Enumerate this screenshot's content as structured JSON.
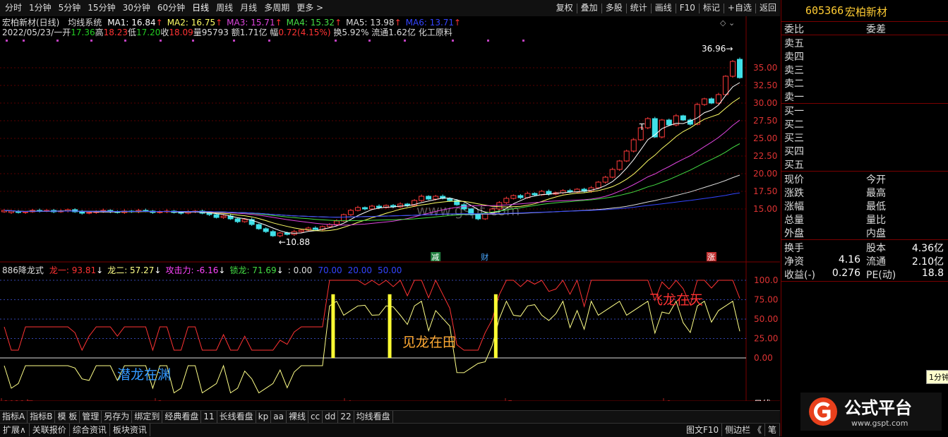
{
  "toolbar": {
    "periods": [
      "分时",
      "1分钟",
      "5分钟",
      "15分钟",
      "30分钟",
      "60分钟",
      "日线",
      "周线",
      "月线",
      "多周期",
      "更多 >"
    ],
    "active_period": "日线",
    "right_buttons": [
      "复权",
      "叠加",
      "多股",
      "统计",
      "画线",
      "F10",
      "标记",
      "+自选",
      "返回"
    ]
  },
  "stock": {
    "title": "宏柏新材(日线)",
    "indicator_name": "均线系统",
    "info_line": {
      "date": "2022/05/23/一",
      "open_label": "开",
      "open": "17.36",
      "high_label": "高",
      "high": "18.23",
      "low_label": "低",
      "low": "17.20",
      "close_label": "收",
      "close": "18.09",
      "vol_label": "量",
      "vol": "95793",
      "amount_label": "额",
      "amount": "1.71亿",
      "range_label": "幅",
      "range": "0.72(4.15%)",
      "turnover_label": "换",
      "turnover": "5.92%",
      "float_label": "流通",
      "float": "1.62亿",
      "sector": "化工原料"
    },
    "ma": [
      {
        "label": "MA1: 16.84",
        "color": "#ffffff"
      },
      {
        "label": "MA2: 16.75",
        "color": "#ffff66"
      },
      {
        "label": "MA3: 15.71",
        "color": "#dd44dd"
      },
      {
        "label": "MA4: 15.32",
        "color": "#44dd44"
      },
      {
        "label": "MA5: 13.98",
        "color": "#dddddd"
      },
      {
        "label": "MA6: 13.71",
        "color": "#3344ff"
      }
    ],
    "high_mark": "36.96",
    "low_mark": "10.88",
    "watermark": "www.gspt.com",
    "event_labels": [
      "减",
      "财",
      "涨"
    ],
    "price_axis": [
      "35.00",
      "32.50",
      "30.00",
      "27.50",
      "25.00",
      "22.50",
      "20.00",
      "17.50",
      "15.00"
    ]
  },
  "sub": {
    "name": "886降龙式",
    "items": [
      {
        "label": "龙一: 93.81",
        "color": "#ff3333"
      },
      {
        "label": "龙二: 57.27",
        "color": "#ffff88"
      },
      {
        "label": "攻击力: -6.16",
        "color": "#ff44ff"
      },
      {
        "label": "锁龙: 71.69",
        "color": "#44dd44"
      },
      {
        "label": ": 0.00",
        "color": "#dddddd"
      },
      {
        "label": "70.00",
        "color": "#3344ff"
      },
      {
        "label": "20.00",
        "color": "#3344ff"
      },
      {
        "label": "50.00",
        "color": "#3344ff"
      }
    ],
    "axis": [
      "100.0",
      "75.00",
      "50.00",
      "25.00",
      "0.00"
    ],
    "texts": [
      "潜龙在渊",
      "见龙在田",
      "飞龙在天"
    ]
  },
  "time_axis": [
    "2022年",
    "3",
    "4",
    "5",
    "6"
  ],
  "period_label": "日线",
  "bottom_tabs": [
    "指标A",
    "指标B",
    "模 板",
    "管理",
    "另存为",
    "绑定到",
    "经典看盘",
    "11",
    "长线看盘",
    "kp",
    "aa",
    "裸线",
    "cc",
    "dd",
    "22",
    "均线看盘"
  ],
  "bottom_bar2": [
    "扩展∧",
    "关联报价",
    "综合资讯",
    "板块资讯"
  ],
  "bottom_right": [
    "图文F10",
    "侧边栏 《",
    "笔"
  ],
  "side": {
    "code": "605366",
    "name": "宏柏新材",
    "ratio_label": "委比",
    "diff_label": "委差",
    "asks": [
      "卖五",
      "卖四",
      "卖三",
      "卖二",
      "卖一"
    ],
    "bids": [
      "买一",
      "买二",
      "买三",
      "买四",
      "买五"
    ],
    "quote_left": [
      "现价",
      "涨跌",
      "涨幅",
      "总量",
      "外盘"
    ],
    "quote_right": [
      "今开",
      "最高",
      "最低",
      "量比",
      "内盘"
    ],
    "fin": [
      {
        "l": "换手",
        "m": "",
        "r": "股本",
        "v": "4.36亿"
      },
      {
        "l": "净资",
        "m": "4.16",
        "r": "流通",
        "v": "2.10亿"
      },
      {
        "l": "收益(-)",
        "m": "0.276",
        "r": "PE(动)",
        "v": "18.8"
      }
    ],
    "tooltip": "1分钟"
  },
  "logo": {
    "text": "公式平台",
    "url": "www.gspt.com"
  },
  "chart_data": {
    "type": "candlestick",
    "symbol": "605366",
    "period": "daily",
    "ylim": [
      9.5,
      37.5
    ],
    "candles": [
      [
        14.6,
        14.8
      ],
      [
        14.5,
        14.7
      ],
      [
        14.6,
        14.5
      ],
      [
        14.5,
        14.6
      ],
      [
        14.6,
        14.8
      ],
      [
        14.8,
        14.7
      ],
      [
        14.7,
        14.8
      ],
      [
        14.8,
        14.6
      ],
      [
        14.6,
        14.7
      ],
      [
        14.7,
        14.9
      ],
      [
        14.9,
        14.6
      ],
      [
        14.6,
        14.4
      ],
      [
        14.4,
        14.5
      ],
      [
        14.5,
        14.6
      ],
      [
        14.6,
        14.8
      ],
      [
        14.8,
        14.6
      ],
      [
        14.6,
        14.5
      ],
      [
        14.5,
        14.7
      ],
      [
        14.7,
        14.6
      ],
      [
        14.6,
        14.8
      ],
      [
        14.8,
        14.7
      ],
      [
        14.7,
        14.5
      ],
      [
        14.5,
        14.6
      ],
      [
        14.6,
        14.7
      ],
      [
        14.7,
        14.5
      ],
      [
        14.5,
        14.4
      ],
      [
        14.4,
        14.6
      ],
      [
        14.6,
        14.7
      ],
      [
        14.7,
        14.4
      ],
      [
        14.4,
        14.2
      ],
      [
        14.2,
        13.8
      ],
      [
        13.8,
        14.0
      ],
      [
        14.0,
        13.6
      ],
      [
        13.6,
        13.2
      ],
      [
        13.2,
        13.5
      ],
      [
        13.5,
        12.8
      ],
      [
        12.8,
        12.2
      ],
      [
        12.2,
        11.8
      ],
      [
        11.8,
        11.2
      ],
      [
        11.2,
        11.6
      ],
      [
        11.6,
        11.4
      ],
      [
        11.4,
        11.8
      ],
      [
        11.8,
        12.0
      ],
      [
        12.0,
        12.3
      ],
      [
        12.3,
        12.1
      ],
      [
        12.1,
        12.5
      ],
      [
        12.5,
        12.8
      ],
      [
        12.8,
        13.3
      ],
      [
        13.3,
        14.2
      ],
      [
        14.2,
        14.8
      ],
      [
        14.8,
        15.2
      ],
      [
        15.2,
        15.0
      ],
      [
        15.0,
        15.4
      ],
      [
        15.4,
        15.2
      ],
      [
        15.2,
        15.5
      ],
      [
        15.5,
        15.3
      ],
      [
        15.3,
        15.7
      ],
      [
        15.7,
        15.5
      ],
      [
        15.5,
        16.2
      ],
      [
        16.2,
        16.8
      ],
      [
        16.8,
        16.4
      ],
      [
        16.4,
        16.8
      ],
      [
        16.8,
        16.5
      ],
      [
        16.5,
        16.2
      ],
      [
        16.2,
        15.6
      ],
      [
        15.6,
        15.0
      ],
      [
        15.0,
        14.2
      ],
      [
        14.2,
        13.6
      ],
      [
        13.6,
        14.4
      ],
      [
        14.4,
        15.0
      ],
      [
        15.0,
        15.9
      ],
      [
        15.9,
        16.5
      ],
      [
        16.5,
        16.9
      ],
      [
        16.9,
        16.6
      ],
      [
        16.6,
        17.2
      ],
      [
        17.2,
        17.0
      ],
      [
        17.0,
        17.5
      ],
      [
        17.5,
        17.1
      ],
      [
        17.1,
        17.3
      ],
      [
        17.3,
        17.6
      ],
      [
        17.6,
        17.4
      ],
      [
        17.4,
        17.8
      ],
      [
        17.8,
        17.5
      ],
      [
        17.5,
        18.0
      ],
      [
        18.0,
        18.8
      ],
      [
        18.8,
        19.5
      ],
      [
        19.5,
        20.6
      ],
      [
        20.6,
        21.8
      ],
      [
        21.8,
        23.2
      ],
      [
        23.2,
        24.8
      ],
      [
        24.8,
        26.5
      ],
      [
        26.5,
        27.8
      ],
      [
        27.8,
        25.2
      ],
      [
        25.2,
        27.6
      ],
      [
        27.6,
        26.9
      ],
      [
        26.9,
        28.2
      ],
      [
        28.2,
        27.6
      ],
      [
        27.6,
        27.0
      ],
      [
        27.0,
        29.8
      ],
      [
        29.8,
        30.6
      ],
      [
        30.6,
        30.0
      ],
      [
        30.0,
        31.2
      ],
      [
        31.2,
        33.8
      ],
      [
        33.8,
        35.9
      ],
      [
        36.2,
        33.6
      ]
    ],
    "sub_series": {
      "long1_last": 93.81,
      "long2_last": 57.27
    }
  }
}
